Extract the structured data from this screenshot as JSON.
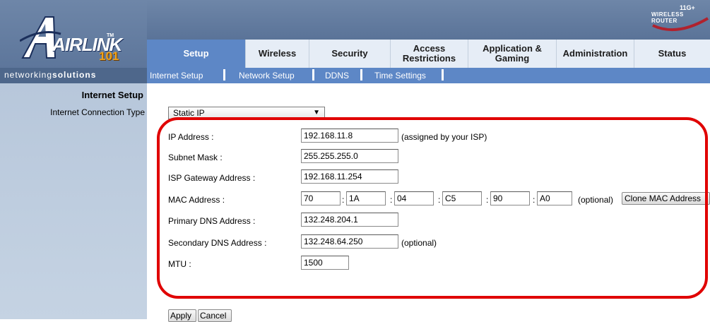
{
  "header": {
    "logo_text": "AIRLINK",
    "logo_tm": "TM",
    "logo_number": "101",
    "tagline_light": "networking",
    "tagline_bold": "solutions",
    "brand_badge_main": "WIRELESS ROUTER",
    "brand_badge_top": "11G+"
  },
  "tabs": [
    {
      "line1": "Setup",
      "line2": "",
      "active": true
    },
    {
      "line1": "Wireless",
      "line2": ""
    },
    {
      "line1": "Security",
      "line2": ""
    },
    {
      "line1": "Access",
      "line2": "Restrictions"
    },
    {
      "line1": "Application &",
      "line2": "Gaming"
    },
    {
      "line1": "Administration",
      "line2": ""
    },
    {
      "line1": "Status",
      "line2": ""
    }
  ],
  "sub_nav": [
    "Internet Setup",
    "Network Setup",
    "DDNS",
    "Time Settings"
  ],
  "side": {
    "title": "Internet Setup",
    "connection_type_label": "Internet Connection Type"
  },
  "form": {
    "connection_type": "Static IP",
    "ip_label": "IP Address :",
    "ip_value": "192.168.11.8",
    "ip_note": "(assigned by your ISP)",
    "subnet_label": "Subnet Mask :",
    "subnet_value": "255.255.255.0",
    "gateway_label": "ISP Gateway Address :",
    "gateway_value": "192.168.11.254",
    "mac_label": "MAC Address :",
    "mac_values": [
      "70",
      "1A",
      "04",
      "C5",
      "90",
      "A0"
    ],
    "mac_note": "(optional)",
    "clone_mac_label": "Clone MAC Address",
    "dns1_label": "Primary DNS Address :",
    "dns1_value": "132.248.204.1",
    "dns2_label": "Secondary DNS Address :",
    "dns2_value": "132.248.64.250",
    "dns2_note": "(optional)",
    "mtu_label": "MTU :",
    "mtu_value": "1500"
  },
  "actions": {
    "apply_label": "Apply",
    "cancel_label": "Cancel"
  },
  "colors": {
    "header_blue": "#6e86a8",
    "tab_active": "#5d87c6",
    "highlight_red": "#e00000",
    "logo_orange": "#f0a21b"
  }
}
